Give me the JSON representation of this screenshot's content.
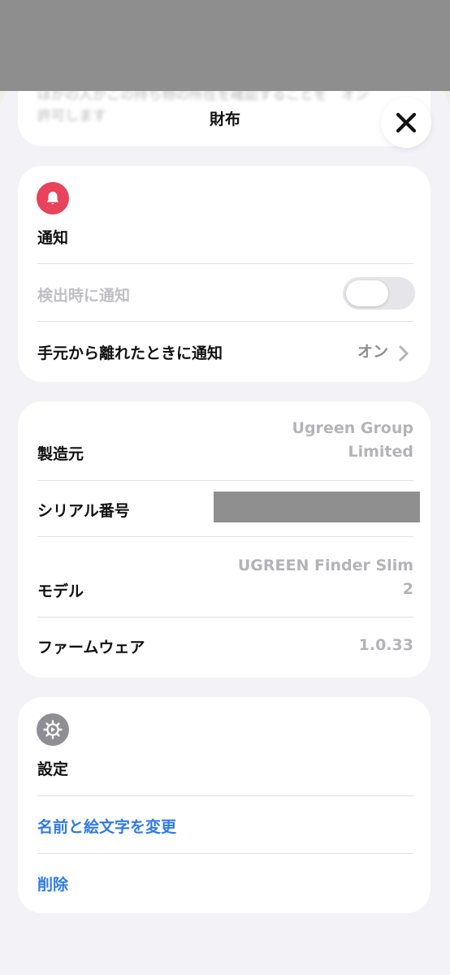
{
  "header": {
    "title": "財布",
    "peek_line1": "ほかの人がこの持ち物の所在を確認することを",
    "peek_line2": "許可します",
    "peek_value": "オン"
  },
  "notifications": {
    "section_title": "通知",
    "icon": "bell-icon",
    "accent_color": "#e8435a",
    "notify_when_found": {
      "label": "検出時に通知",
      "toggle_on": false
    },
    "notify_when_left_behind": {
      "label": "手元から離れたときに通知",
      "value": "オン"
    }
  },
  "device_info": {
    "manufacturer": {
      "label": "製造元",
      "value_line1": "Ugreen Group",
      "value_line2": "Limited"
    },
    "serial": {
      "label": "シリアル番号"
    },
    "model": {
      "label": "モデル",
      "value_line1": "UGREEN Finder Slim",
      "value_line2": "2"
    },
    "firmware": {
      "label": "ファームウェア",
      "value": "1.0.33"
    }
  },
  "settings": {
    "section_title": "設定",
    "icon": "gear-icon",
    "icon_color": "#8e8e93",
    "rename_label": "名前と絵文字を変更",
    "delete_label": "削除",
    "link_color": "#2f7be5"
  }
}
